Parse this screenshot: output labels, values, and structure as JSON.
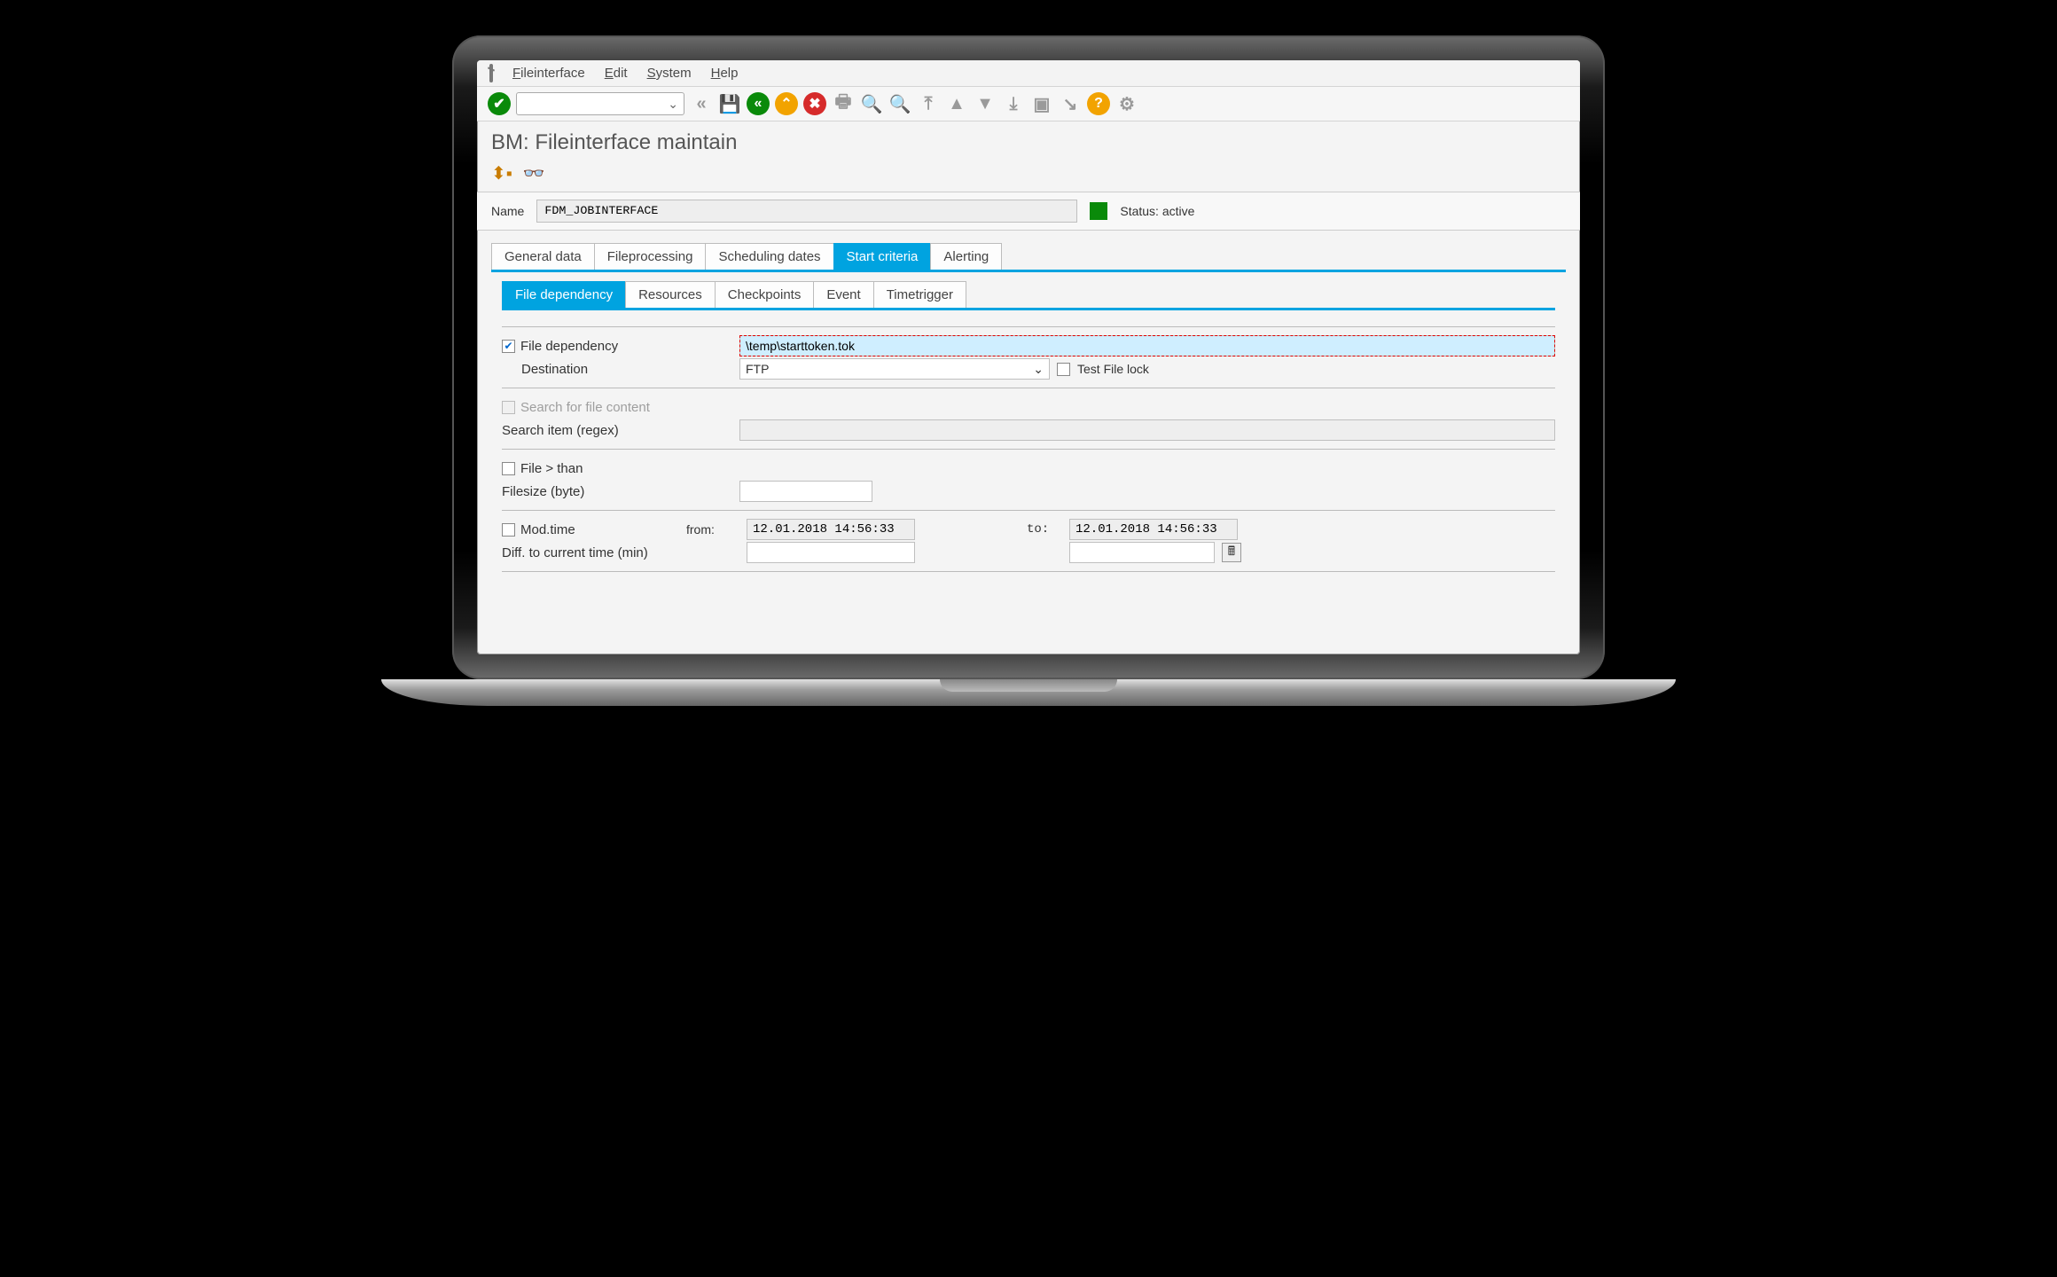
{
  "menu": {
    "items": [
      "Fileinterface",
      "Edit",
      "System",
      "Help"
    ]
  },
  "title": "BM: Fileinterface maintain",
  "name": {
    "label": "Name",
    "value": "FDM_JOBINTERFACE"
  },
  "status": {
    "label": "Status: active"
  },
  "tabs": {
    "main": [
      "General data",
      "Fileprocessing",
      "Scheduling dates",
      "Start criteria",
      "Alerting"
    ],
    "main_active": 3,
    "sub": [
      "File dependency",
      "Resources",
      "Checkpoints",
      "Event",
      "Timetrigger"
    ],
    "sub_active": 0
  },
  "fd": {
    "check_label": "File dependency",
    "checked": true,
    "path": "\\temp\\starttoken.tok",
    "dest_label": "Destination",
    "dest_value": "FTP",
    "testlock_label": "Test File lock"
  },
  "search": {
    "toggle": "Search for file content",
    "item_label": "Search item (regex)"
  },
  "size": {
    "toggle": "File > than",
    "label": "Filesize (byte)"
  },
  "mod": {
    "toggle": "Mod.time",
    "from_label": "from:",
    "to_label": "to:",
    "from": "12.01.2018 14:56:33",
    "to": "12.01.2018 14:56:33",
    "diff_label": "Diff. to current time (min)"
  }
}
